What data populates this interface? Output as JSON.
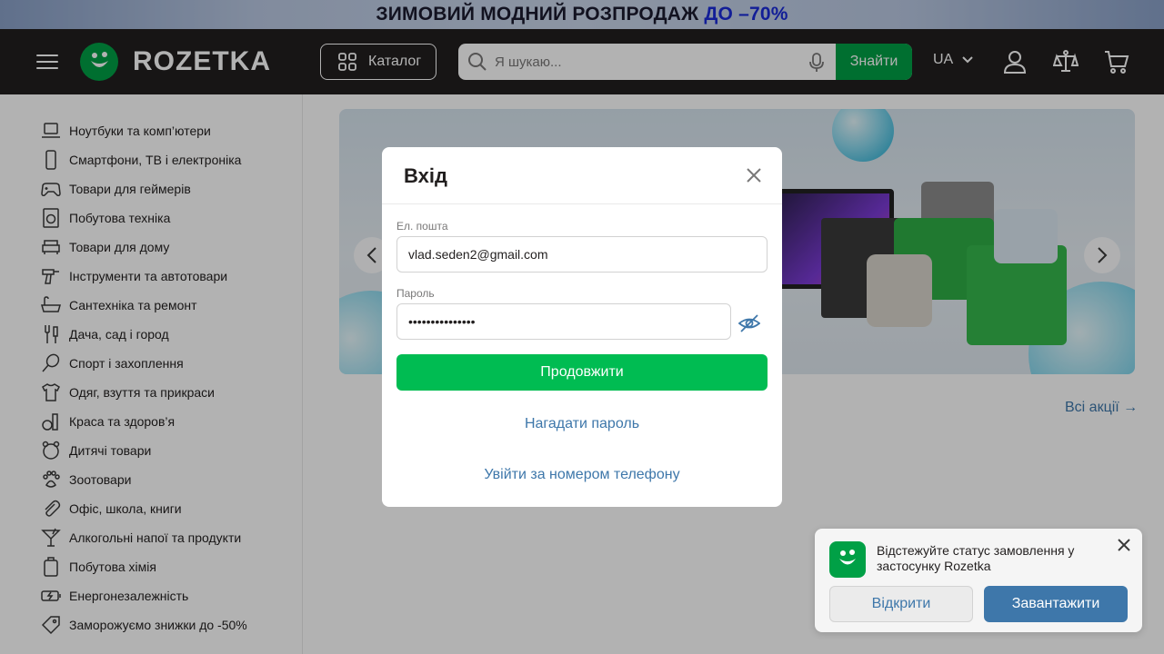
{
  "promo": {
    "text_main": "ЗИМОВИЙ МОДНИЙ РОЗПРОДАЖ",
    "text_accent": "ДО –70%"
  },
  "header": {
    "logo_text": "ROZETKA",
    "catalog_label": "Каталог",
    "search_placeholder": "Я шукаю...",
    "search_button": "Знайти",
    "language": "UA"
  },
  "sidebar": {
    "items": [
      {
        "label": "Ноутбуки та комп’ютери",
        "icon": "laptop-icon"
      },
      {
        "label": "Смартфони, ТВ і електроніка",
        "icon": "smartphone-icon"
      },
      {
        "label": "Товари для геймерів",
        "icon": "gamepad-icon"
      },
      {
        "label": "Побутова техніка",
        "icon": "washing-machine-icon"
      },
      {
        "label": "Товари для дому",
        "icon": "armchair-icon"
      },
      {
        "label": "Інструменти та автотовари",
        "icon": "drill-icon"
      },
      {
        "label": "Сантехніка та ремонт",
        "icon": "bathtub-icon"
      },
      {
        "label": "Дача, сад і город",
        "icon": "garden-fork-icon"
      },
      {
        "label": "Спорт і захоплення",
        "icon": "racket-icon"
      },
      {
        "label": "Одяг, взуття та прикраси",
        "icon": "tshirt-icon"
      },
      {
        "label": "Краса та здоров’я",
        "icon": "cosmetics-icon"
      },
      {
        "label": "Дитячі товари",
        "icon": "teddy-bear-icon"
      },
      {
        "label": "Зоотовари",
        "icon": "paw-icon"
      },
      {
        "label": "Офіс, школа, книги",
        "icon": "paperclip-icon"
      },
      {
        "label": "Алкогольні напої та продукти",
        "icon": "cocktail-icon"
      },
      {
        "label": "Побутова хімія",
        "icon": "detergent-bottle-icon"
      },
      {
        "label": "Енергонезалежність",
        "icon": "battery-bolt-icon"
      },
      {
        "label": "Заморожуємо знижки до -50%",
        "icon": "price-tag-icon"
      }
    ]
  },
  "main": {
    "all_promotions": "Всі акції →"
  },
  "login_modal": {
    "title": "Вхід",
    "email_label": "Ел. пошта",
    "email_value": "vlad.seden2@gmail.com",
    "password_label": "Пароль",
    "password_value": "•••••••••••••••",
    "continue_button": "Продовжити",
    "forgot_password": "Нагадати пароль",
    "phone_login": "Увійти за номером телефону"
  },
  "app_toast": {
    "message": "Відстежуйте статус замовлення у застосунку Rozetka",
    "open_button": "Відкрити",
    "download_button": "Завантажити"
  },
  "colors": {
    "brand_green": "#00a046",
    "button_green": "#00bc52",
    "link_blue": "#3e77aa",
    "header_dark": "#221f1f"
  }
}
